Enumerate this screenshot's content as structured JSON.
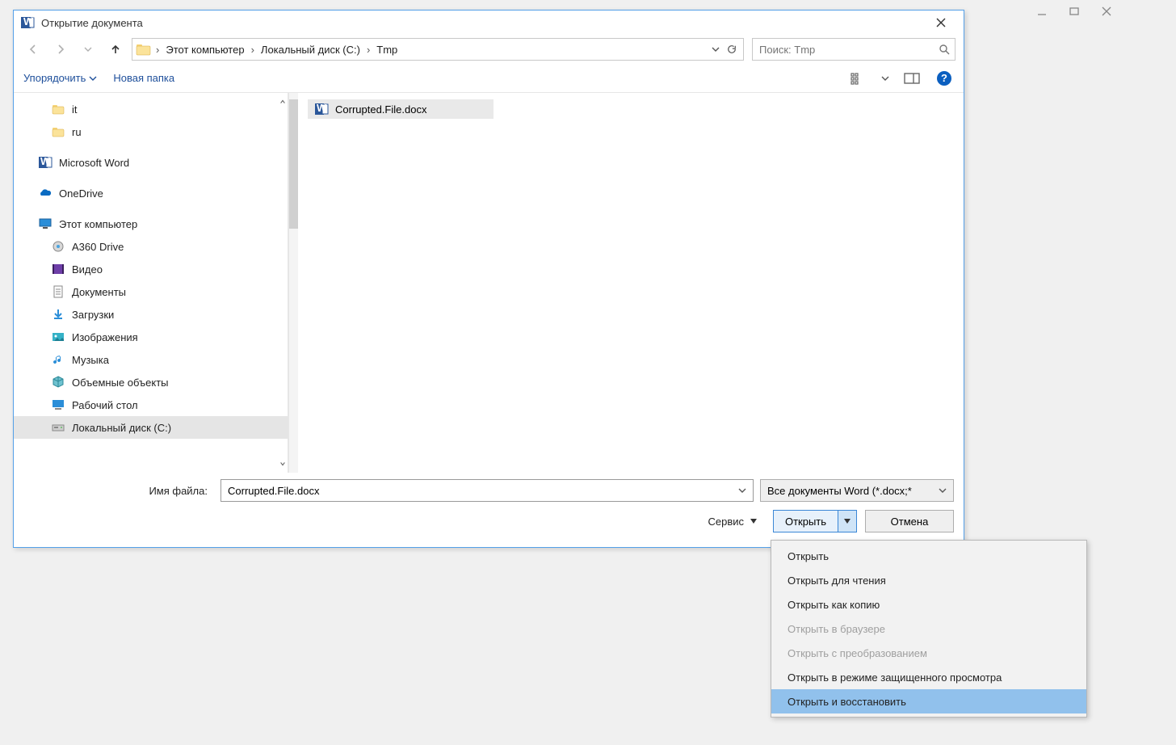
{
  "dialog": {
    "title": "Открытие документа"
  },
  "breadcrumb": {
    "items": [
      "Этот компьютер",
      "Локальный диск (C:)",
      "Tmp"
    ]
  },
  "search": {
    "placeholder": "Поиск: Tmp"
  },
  "toolbar": {
    "organize": "Упорядочить",
    "newfolder": "Новая папка"
  },
  "sidebar": {
    "items": [
      {
        "label": "it",
        "icon": "folder",
        "indent": "child"
      },
      {
        "label": "ru",
        "icon": "folder",
        "indent": "child"
      },
      {
        "label": "Microsoft Word",
        "icon": "word",
        "indent": "root"
      },
      {
        "label": "OneDrive",
        "icon": "onedrive",
        "indent": "root"
      },
      {
        "label": "Этот компьютер",
        "icon": "thispc",
        "indent": "root"
      },
      {
        "label": "A360 Drive",
        "icon": "a360",
        "indent": "child"
      },
      {
        "label": "Видео",
        "icon": "video",
        "indent": "child"
      },
      {
        "label": "Документы",
        "icon": "docs",
        "indent": "child"
      },
      {
        "label": "Загрузки",
        "icon": "downloads",
        "indent": "child"
      },
      {
        "label": "Изображения",
        "icon": "pictures",
        "indent": "child"
      },
      {
        "label": "Музыка",
        "icon": "music",
        "indent": "child"
      },
      {
        "label": "Объемные объекты",
        "icon": "3d",
        "indent": "child"
      },
      {
        "label": "Рабочий стол",
        "icon": "desktop",
        "indent": "child"
      },
      {
        "label": "Локальный диск (C:)",
        "icon": "disk",
        "indent": "child",
        "selected": true
      }
    ]
  },
  "files": [
    {
      "name": "Corrupted.File.docx",
      "icon": "word"
    }
  ],
  "footer": {
    "filename_label": "Имя файла:",
    "filename_value": "Corrupted.File.docx",
    "filetype": "Все документы Word (*.docx;*",
    "service_label": "Сервис",
    "open_label": "Открыть",
    "cancel_label": "Отмена"
  },
  "dropdown": {
    "items": [
      {
        "label": "Открыть",
        "state": "normal"
      },
      {
        "label": "Открыть для чтения",
        "state": "normal"
      },
      {
        "label": "Открыть как копию",
        "state": "normal"
      },
      {
        "label": "Открыть в браузере",
        "state": "disabled"
      },
      {
        "label": "Открыть с преобразованием",
        "state": "disabled"
      },
      {
        "label": "Открыть в режиме защищенного просмотра",
        "state": "normal"
      },
      {
        "label": "Открыть и восстановить",
        "state": "highlight"
      }
    ]
  }
}
